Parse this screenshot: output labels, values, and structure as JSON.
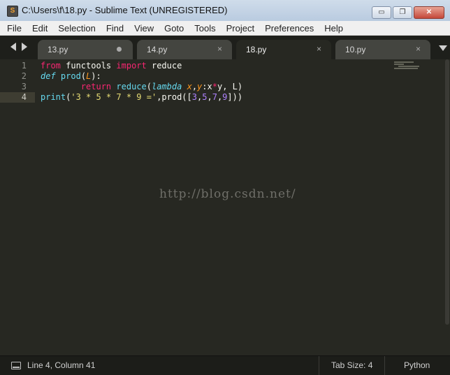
{
  "window": {
    "title": "C:\\Users\\f\\18.py - Sublime Text (UNREGISTERED)",
    "app_icon_glyph": "S",
    "controls": {
      "minimize": "▭",
      "maximize": "❐",
      "close": "✕"
    }
  },
  "menu": {
    "items": [
      "File",
      "Edit",
      "Selection",
      "Find",
      "View",
      "Goto",
      "Tools",
      "Project",
      "Preferences",
      "Help"
    ]
  },
  "tabs": [
    {
      "label": "13.py",
      "active": false,
      "modified": true
    },
    {
      "label": "14.py",
      "active": false,
      "modified": false
    },
    {
      "label": "18.py",
      "active": true,
      "modified": false
    },
    {
      "label": "10.py",
      "active": false,
      "modified": false
    }
  ],
  "tab_close_glyph": "×",
  "editor": {
    "line_numbers": [
      "1",
      "2",
      "3",
      "4"
    ],
    "current_line": 4,
    "lines": [
      [
        {
          "t": "from",
          "c": "kw"
        },
        {
          "t": " functools ",
          "c": "plain"
        },
        {
          "t": "import",
          "c": "kw"
        },
        {
          "t": " reduce",
          "c": "plain"
        }
      ],
      [
        {
          "t": "def",
          "c": "kwi"
        },
        {
          "t": " ",
          "c": "plain"
        },
        {
          "t": "prod",
          "c": "bi"
        },
        {
          "t": "(",
          "c": "plain"
        },
        {
          "t": "L",
          "c": "param"
        },
        {
          "t": "):",
          "c": "plain"
        }
      ],
      [
        {
          "t": "        ",
          "c": "plain"
        },
        {
          "t": "return",
          "c": "kw"
        },
        {
          "t": " ",
          "c": "plain"
        },
        {
          "t": "reduce",
          "c": "bi"
        },
        {
          "t": "(",
          "c": "plain"
        },
        {
          "t": "lambda",
          "c": "kwi"
        },
        {
          "t": " ",
          "c": "plain"
        },
        {
          "t": "x",
          "c": "param"
        },
        {
          "t": ",",
          "c": "plain"
        },
        {
          "t": "y",
          "c": "param"
        },
        {
          "t": ":x",
          "c": "plain"
        },
        {
          "t": "*",
          "c": "op"
        },
        {
          "t": "y, L)",
          "c": "plain"
        }
      ],
      [
        {
          "t": "print",
          "c": "bi"
        },
        {
          "t": "(",
          "c": "plain"
        },
        {
          "t": "'3 * 5 * 7 * 9 ='",
          "c": "str"
        },
        {
          "t": ",prod([",
          "c": "plain"
        },
        {
          "t": "3",
          "c": "num"
        },
        {
          "t": ",",
          "c": "plain"
        },
        {
          "t": "5",
          "c": "num"
        },
        {
          "t": ",",
          "c": "plain"
        },
        {
          "t": "7",
          "c": "num"
        },
        {
          "t": ",",
          "c": "plain"
        },
        {
          "t": "9",
          "c": "num"
        },
        {
          "t": "]))",
          "c": "plain"
        }
      ]
    ],
    "watermark": "http://blog.csdn.net/"
  },
  "colors": {
    "background": "#272822",
    "keyword": "#f92672",
    "builtin": "#66d9ef",
    "parameter": "#fd971f",
    "string": "#e6db74",
    "number": "#ae81ff"
  },
  "status": {
    "position": "Line 4, Column 41",
    "tab_size": "Tab Size: 4",
    "syntax": "Python",
    "panel_icon": "panel-toggle-icon"
  }
}
